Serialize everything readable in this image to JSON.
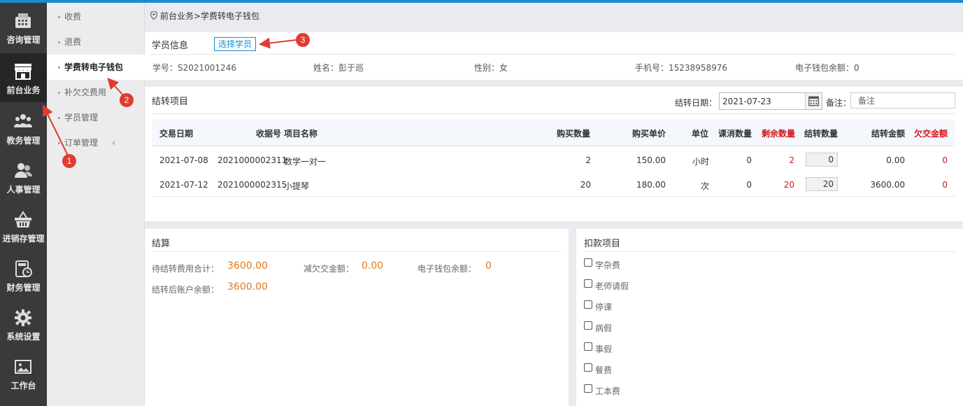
{
  "leftnav": {
    "items": [
      {
        "label": "咨询管理",
        "icon": "phone-icon"
      },
      {
        "label": "前台业务",
        "icon": "storefront-icon"
      },
      {
        "label": "教务管理",
        "icon": "people-group-icon"
      },
      {
        "label": "人事管理",
        "icon": "users-icon"
      },
      {
        "label": "进销存管理",
        "icon": "basket-icon"
      },
      {
        "label": "财务管理",
        "icon": "calculator-icon"
      },
      {
        "label": "系统设置",
        "icon": "gear-icon"
      },
      {
        "label": "工作台",
        "icon": "picture-icon"
      }
    ]
  },
  "subnav": {
    "items": [
      "收费",
      "退费",
      "学费转电子钱包",
      "补欠交费用",
      "学员管理",
      "订单管理"
    ],
    "chevron": "‹"
  },
  "breadcrumb": "前台业务>学费转电子钱包",
  "student": {
    "title": "学员信息",
    "select_label": "选择学员",
    "id_label": "学号：S2021001246",
    "name_label": "姓名：彭于巡",
    "gender_label": "性别：女",
    "phone_label": "手机号：15238958976",
    "wallet_label": "电子钱包余额：0"
  },
  "transfer": {
    "title": "结转项目",
    "date_label": "结转日期：",
    "date_value": "2021-07-23",
    "note_label": "备注：",
    "note_placeholder": "备注",
    "columns": [
      "交易日期",
      "收据号",
      "项目名称",
      "购买数量",
      "购买单价",
      "单位",
      "课消数量",
      "剩余数量",
      "结转数量",
      "结转金额",
      "欠交金额"
    ],
    "rows": [
      {
        "date": "2021-07-08",
        "receipt": "2021000002311",
        "item": "数学一对一",
        "qty": "2",
        "price": "150.00",
        "unit": "小时",
        "used": "0",
        "remain": "2",
        "transfer_qty": "0",
        "amount": "0.00",
        "owed": "0"
      },
      {
        "date": "2021-07-12",
        "receipt": "2021000002315",
        "item": "小提琴",
        "qty": "20",
        "price": "180.00",
        "unit": "次",
        "used": "0",
        "remain": "20",
        "transfer_qty": "20",
        "amount": "3600.00",
        "owed": "0"
      }
    ]
  },
  "settlement": {
    "title": "结算",
    "pending_label": "待结转费用合计：",
    "pending_value": "3600.00",
    "reduce_label": "减欠交金额：",
    "reduce_value": "0.00",
    "wallet_label": "电子钱包余额：",
    "wallet_value": "0",
    "after_label": "结转后账户余额：",
    "after_value": "3600.00"
  },
  "deductions": {
    "title": "扣款项目",
    "items": [
      "学杂费",
      "老师请假",
      "停课",
      "病假",
      "事假",
      "餐费",
      "工本费"
    ]
  },
  "annotations": [
    "1",
    "2",
    "3"
  ],
  "colors": {
    "accent": "#1a8bd0",
    "red": "#d9121b",
    "orange": "#e07a1c",
    "nav_bg": "#3a3a3a"
  }
}
